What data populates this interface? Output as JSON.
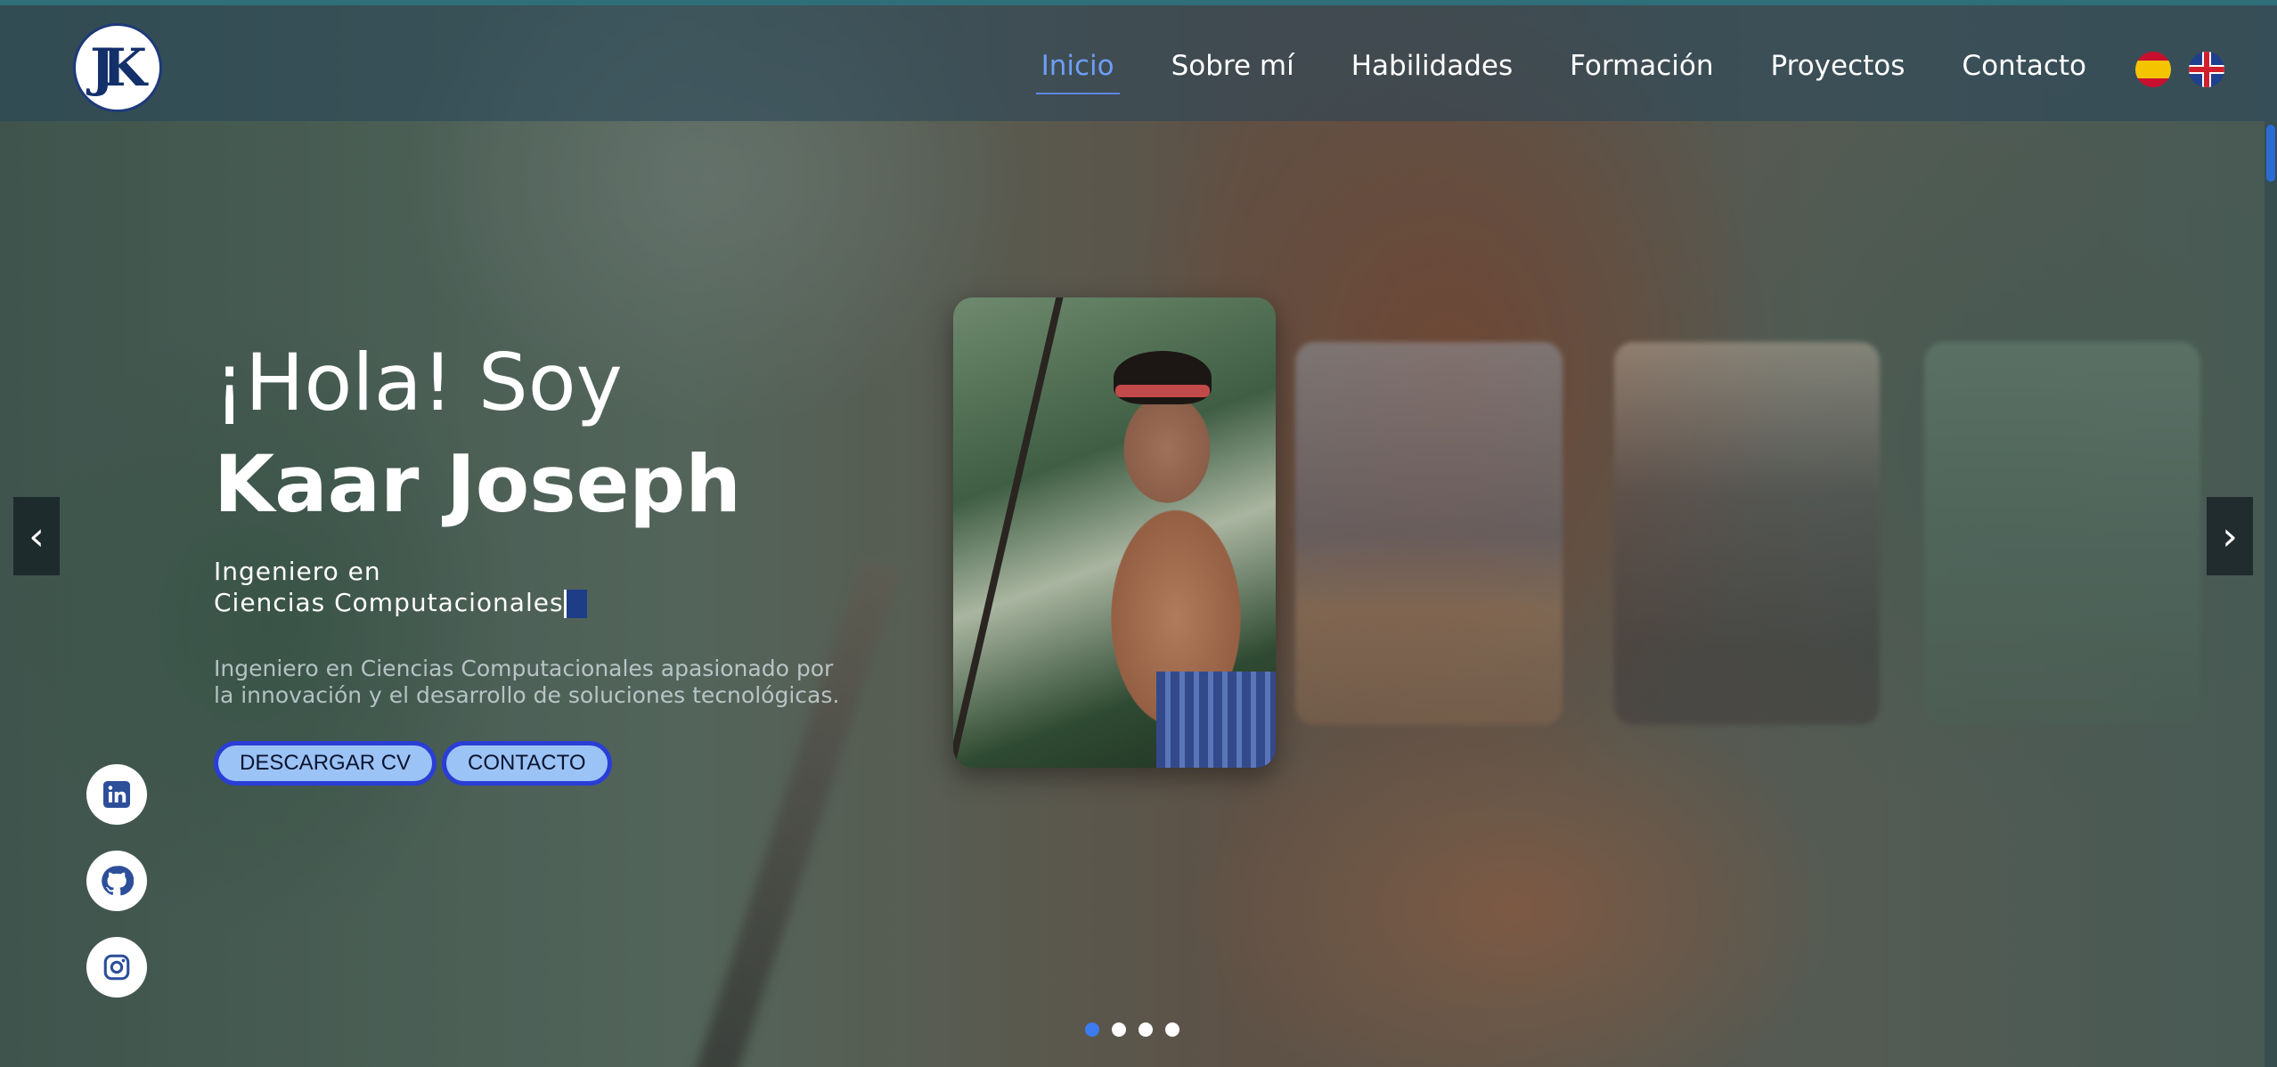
{
  "nav": {
    "logo_text": "JK",
    "items": [
      {
        "label": "Inicio",
        "active": true
      },
      {
        "label": "Sobre mí",
        "active": false
      },
      {
        "label": "Habilidades",
        "active": false
      },
      {
        "label": "Formación",
        "active": false
      },
      {
        "label": "Proyectos",
        "active": false
      },
      {
        "label": "Contacto",
        "active": false
      }
    ],
    "languages": [
      "es-flag-icon",
      "uk-flag-icon"
    ]
  },
  "hero": {
    "greeting": "¡Hola! Soy",
    "name": "Kaar Joseph",
    "role_line1": "Ingeniero en",
    "role_line2": "Ciencias Computacionales",
    "description": "Ingeniero en Ciencias Computacionales apasionado por la innovación y el desarrollo de soluciones tecnológicas.",
    "btn_cv": "DESCARGAR CV",
    "btn_contact": "CONTACTO"
  },
  "social": [
    "linkedin-icon",
    "github-icon",
    "instagram-icon"
  ],
  "carousel": {
    "prev": "‹",
    "next": "›",
    "slide_count": 4,
    "active_slide": 1
  },
  "colors": {
    "accent": "#5d87e4",
    "button_bg": "#9cc3f5",
    "button_border": "#2a3ed6",
    "active_dot": "#3d7cf0"
  }
}
